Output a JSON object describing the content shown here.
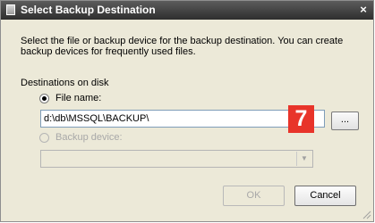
{
  "window": {
    "title": "Select Backup Destination",
    "close_glyph": "×"
  },
  "description": "Select the file or backup device for the backup destination. You can create backup devices for frequently used files.",
  "destinations": {
    "section_label": "Destinations on disk",
    "file_name": {
      "label": "File name:",
      "selected": true,
      "value": "d:\\db\\MSSQL\\BACKUP\\"
    },
    "browse_label": "...",
    "backup_device": {
      "label": "Backup device:",
      "selected": false,
      "enabled": false,
      "selected_value": ""
    }
  },
  "callout": {
    "number": "7",
    "color": "#e8342a"
  },
  "buttons": {
    "ok_label": "OK",
    "ok_enabled": false,
    "cancel_label": "Cancel"
  },
  "icons": {
    "window_icon": "window-icon",
    "close": "close-icon",
    "dropdown": "chevron-down-icon",
    "resize": "resize-grip-icon"
  }
}
